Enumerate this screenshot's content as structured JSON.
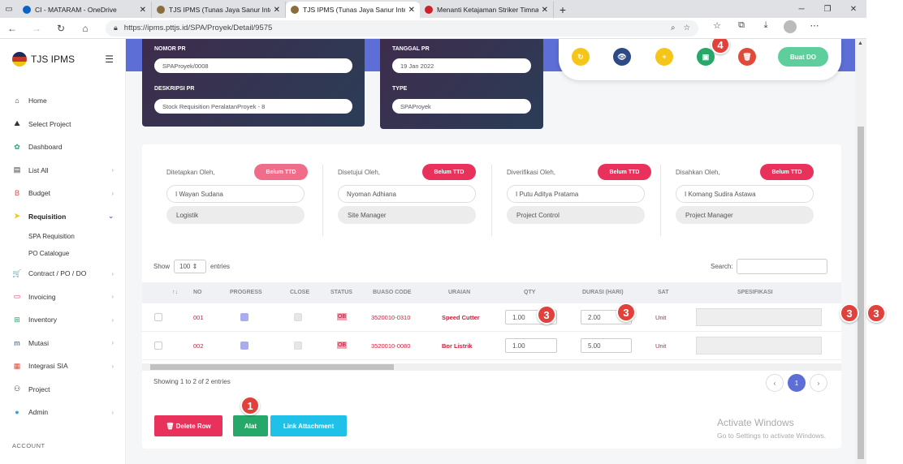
{
  "browser": {
    "tabs": [
      {
        "label": "CI - MATARAM - OneDrive",
        "color": "#0a64c8"
      },
      {
        "label": "TJS IPMS (Tunas Jaya Sanur Integ",
        "color": "#8a6d3b"
      },
      {
        "label": "TJS IPMS (Tunas Jaya Sanur Integ",
        "color": "#8a6d3b"
      },
      {
        "label": "Menanti Ketajaman Striker Timna",
        "color": "#d0202a"
      }
    ],
    "url": "https://ipms.pttjs.id/SPA/Proyek/Detail/9575"
  },
  "sidebar": {
    "brand": "TJS IPMS",
    "items": [
      {
        "label": "Home",
        "icon": "home-icon",
        "glyph": "⌂",
        "chev": ""
      },
      {
        "label": "Select Project",
        "icon": "road-icon",
        "glyph": "⛰",
        "chev": ""
      },
      {
        "label": "Dashboard",
        "icon": "gear-icon",
        "glyph": "✿",
        "chev": ""
      },
      {
        "label": "List All",
        "icon": "clipboard-icon",
        "glyph": "▤",
        "chev": "›"
      },
      {
        "label": "Budget",
        "icon": "budget-icon",
        "glyph": "B",
        "chev": "›"
      },
      {
        "label": "Requisition",
        "icon": "send-icon",
        "glyph": "➤",
        "chev": "⌄"
      }
    ],
    "subitems": [
      "SPA Requisition",
      "PO Catalogue"
    ],
    "items2": [
      {
        "label": "Contract / PO / DO",
        "icon": "cart-icon",
        "glyph": "🛒",
        "chev": "›"
      },
      {
        "label": "Invoicing",
        "icon": "card-icon",
        "glyph": "▭",
        "chev": "›"
      },
      {
        "label": "Inventory",
        "icon": "gift-icon",
        "glyph": "⊞",
        "chev": "›"
      },
      {
        "label": "Mutasi",
        "icon": "m-icon",
        "glyph": "m",
        "chev": "›"
      },
      {
        "label": "Integrasi SIA",
        "icon": "doc-icon",
        "glyph": "▦",
        "chev": "›"
      },
      {
        "label": "Project",
        "icon": "sitemap-icon",
        "glyph": "⚇",
        "chev": ""
      },
      {
        "label": "Admin",
        "icon": "user-icon",
        "glyph": "●",
        "chev": "›"
      }
    ],
    "account": "ACCOUNT"
  },
  "header": {
    "nomor_label": "NOMOR PR",
    "nomor_value": "SPAProyek/0008",
    "deskripsi_label": "DESKRIPSI PR",
    "deskripsi_value": "Stock Requisition PeralatanProyek - 8",
    "tanggal_label": "TANGGAL PR",
    "tanggal_value": "19 Jan 2022",
    "type_label": "TYPE",
    "type_value": "SPAProyek"
  },
  "actions": {
    "buat_do": "Buat DO",
    "badge4": "4"
  },
  "approvers": [
    {
      "label": "Ditetapkan Oleh,",
      "status": "Belum TTD",
      "name": "I Wayan Sudana",
      "role": "Logistik"
    },
    {
      "label": "Disetujui Oleh,",
      "status": "Belum TTD",
      "name": "Nyoman Adhiana",
      "role": "Site Manager"
    },
    {
      "label": "Diverifikasi Oleh,",
      "status": "Belum TTD",
      "name": "I Putu Aditya Pratama",
      "role": "Project Control"
    },
    {
      "label": "Disahkan Oleh,",
      "status": "Belum TTD",
      "name": "I Komang Sudira Astawa",
      "role": "Project Manager"
    }
  ],
  "table": {
    "show_label": "Show",
    "show_value": "100",
    "entries_label": "entries",
    "search_label": "Search:",
    "headers": [
      "NO",
      "PROGRESS",
      "CLOSE",
      "STATUS",
      "BUASO CODE",
      "URAIAN",
      "QTY",
      "DURASI (HARI)",
      "SAT",
      "SPESIFIKASI"
    ],
    "rows": [
      {
        "no": "001",
        "status": "OB",
        "code": "3520010-0310",
        "uraian": "Speed Cutter",
        "qty": "1.00",
        "durasi": "2.00",
        "sat": "Unit"
      },
      {
        "no": "002",
        "status": "OB",
        "code": "3520010-0080",
        "uraian": "Bor Listrik",
        "qty": "1.00",
        "durasi": "5.00",
        "sat": "Unit"
      }
    ],
    "showing": "Showing 1 to 2 of 2 entries",
    "page": "1"
  },
  "buttons": {
    "delete": "Delete Row",
    "alat": "Alat",
    "link": "Link Attachment"
  },
  "annotations": {
    "one": "1",
    "three": "3",
    "four": "4"
  },
  "watermark": {
    "title": "Activate Windows",
    "subtitle": "Go to Settings to activate Windows."
  }
}
